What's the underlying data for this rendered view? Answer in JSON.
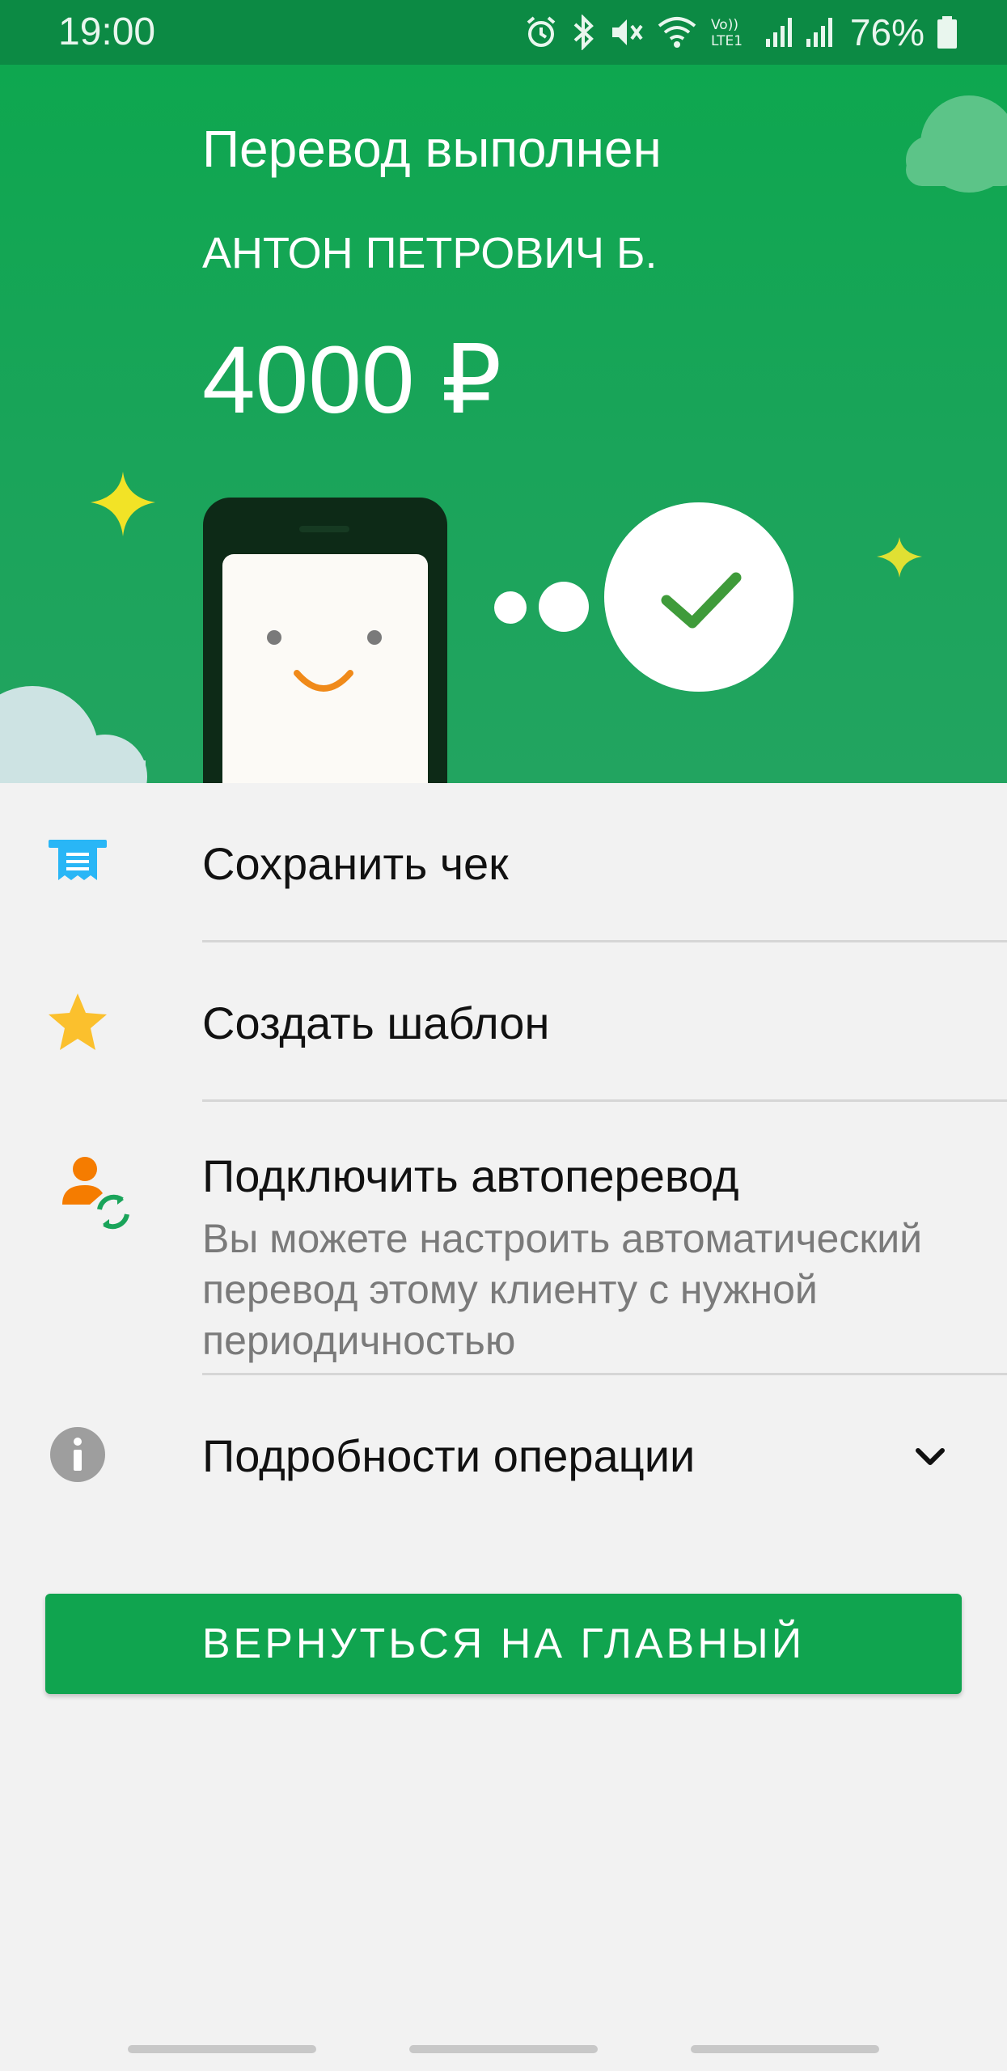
{
  "status_bar": {
    "time": "19:00",
    "battery": "76%",
    "icons": [
      "alarm-icon",
      "bluetooth-icon",
      "vibrate-off-icon",
      "wifi-icon",
      "volte-lte-icon",
      "signal-icon",
      "signal-icon",
      "battery-icon"
    ]
  },
  "hero": {
    "title": "Перевод выполнен",
    "recipient": "АНТОН ПЕТРОВИЧ Б.",
    "amount": "4000 ₽"
  },
  "actions": {
    "save_receipt": {
      "label": "Сохранить чек",
      "icon": "receipt-icon"
    },
    "create_template": {
      "label": "Создать шаблон",
      "icon": "star-icon"
    },
    "autopay": {
      "label": "Подключить автоперевод",
      "description": "Вы можете настроить автоматический перевод этому клиенту с нужной периодичностью",
      "icon": "autopay-person-icon"
    },
    "details": {
      "label": "Подробности операции",
      "icon": "info-icon"
    }
  },
  "return_button": {
    "label": "ВЕРНУТЬСЯ НА ГЛАВНЫЙ"
  },
  "colors": {
    "brand_green": "#10a44f",
    "status_bar": "#0c8a44",
    "receipt_icon": "#29b6f6",
    "star_icon": "#fbc02d",
    "autopay_person": "#f57c00",
    "info_icon": "#9e9e9e"
  }
}
